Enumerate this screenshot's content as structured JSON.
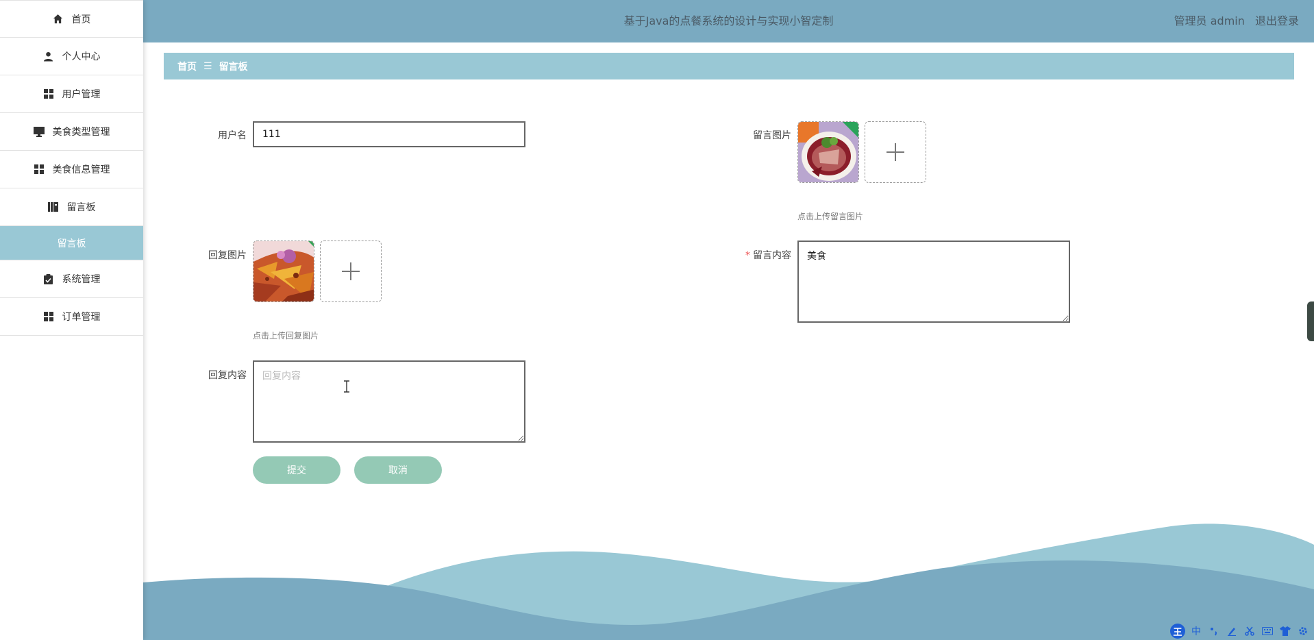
{
  "sidebar": {
    "items": [
      {
        "label": "首页",
        "icon": "home-icon"
      },
      {
        "label": "个人中心",
        "icon": "user-icon"
      },
      {
        "label": "用户管理",
        "icon": "grid-icon"
      },
      {
        "label": "美食类型管理",
        "icon": "monitor-icon"
      },
      {
        "label": "美食信息管理",
        "icon": "grid-icon"
      },
      {
        "label": "留言板",
        "icon": "book-icon"
      },
      {
        "label": "留言板",
        "icon": "",
        "sub": true
      },
      {
        "label": "系统管理",
        "icon": "clipboard-icon"
      },
      {
        "label": "订单管理",
        "icon": "grid-icon"
      }
    ]
  },
  "header": {
    "title": "基于Java的点餐系统的设计与实现小智定制",
    "user_label": "管理员 admin",
    "logout_label": "退出登录",
    "bg_color": "#7aaac1"
  },
  "breadcrumb": {
    "home": "首页",
    "separator": "☰",
    "current": "留言板"
  },
  "form": {
    "username": {
      "label": "用户名",
      "value": "111"
    },
    "message_image": {
      "label": "留言图片",
      "hint": "点击上传留言图片"
    },
    "reply_image": {
      "label": "回复图片",
      "hint": "点击上传回复图片"
    },
    "message_content": {
      "label": "留言内容",
      "required_mark": "*",
      "value": "美食"
    },
    "reply_content": {
      "label": "回复内容",
      "placeholder": "回复内容",
      "value": ""
    },
    "submit_label": "提交",
    "cancel_label": "取消"
  },
  "tray": {
    "ime_badge": "王",
    "ime_mode": "中"
  },
  "colors": {
    "accent": "#99c8d5",
    "button": "#94c9b5",
    "wave_light": "#99c8d5",
    "wave_dark": "#7aaac1"
  }
}
